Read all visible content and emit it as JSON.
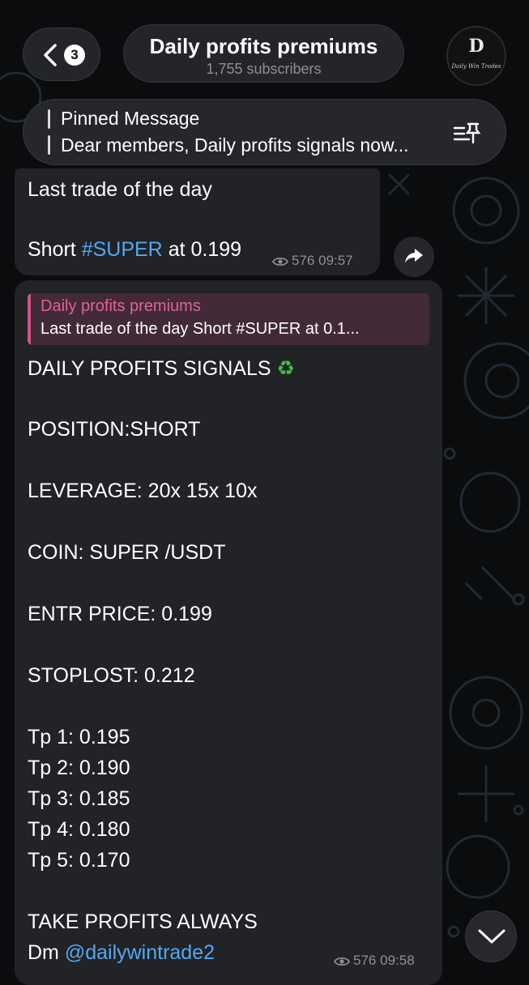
{
  "header": {
    "back_count": "3",
    "title": "Daily profits premiums",
    "subscribers": "1,755 subscribers",
    "avatar_letter": "D",
    "avatar_caption": "Daily Win Trades"
  },
  "pinned": {
    "title": "Pinned Message",
    "text": "Dear members, Daily profits signals now..."
  },
  "messages": [
    {
      "line1": "Last trade of the day",
      "line2_prefix": "Short ",
      "line2_hashtag": "#SUPER",
      "line2_suffix": " at 0.199",
      "views": "576",
      "time": "09:57"
    },
    {
      "reply_name": "Daily profits premiums",
      "reply_text": "Last trade of the day Short #SUPER at 0.1...",
      "lines": [
        "DAILY PROFITS SIGNALS",
        "POSITION:SHORT",
        "LEVERAGE: 20x 15x 10x",
        "COIN: SUPER /USDT",
        "ENTR PRICE: 0.199",
        "STOPLOST: 0.212",
        "Tp 1:  0.195",
        "Tp 2:  0.190",
        "Tp 3: 0.185",
        "Tp 4: 0.180",
        "Tp 5: 0.170",
        "TAKE  PROFITS ALWAYS"
      ],
      "recycle_emoji": "♻",
      "dm_prefix": "Dm ",
      "dm_mention": "@dailywintrade2",
      "views": "576",
      "time": "09:58"
    }
  ],
  "icons": {
    "back": "chevron-left-icon",
    "pin_list": "pinned-list-icon",
    "views": "eye-icon",
    "share": "share-arrow-icon",
    "scroll": "chevron-down-icon"
  },
  "colors": {
    "accent_link": "#52a8f4",
    "reply_accent": "#e0619b",
    "bubble": "#222326",
    "background": "#0b0c0e"
  }
}
